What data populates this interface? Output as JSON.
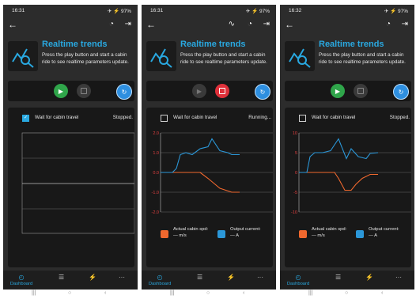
{
  "screens": [
    {
      "status_time": "16:31",
      "status_right": "✈ ⚡ 97%",
      "title": "Realtime trends",
      "description": "Press the play button and start a cabin ride to see realtime parameters update.",
      "checkbox_label": "Wait for cabin travel",
      "checkbox_checked": true,
      "run_state": "Stopped.",
      "play_active": true,
      "stop_active": false,
      "chart_visible": false
    },
    {
      "status_time": "16:31",
      "status_right": "✈ ⚡ 97%",
      "title": "Realtime trends",
      "description": "Press the play button and start a cabin ride to see realtime parameters update.",
      "checkbox_label": "Wait for cabin travel",
      "checkbox_checked": false,
      "run_state": "Running...",
      "play_active": false,
      "stop_active": true,
      "chart_visible": true
    },
    {
      "status_time": "16:32",
      "status_right": "✈ ⚡ 97%",
      "title": "Realtime trends",
      "description": "Press the play button and start a cabin ride to see realtime parameters update.",
      "checkbox_label": "Wait for cabin travel",
      "checkbox_checked": false,
      "run_state": "Stopped.",
      "play_active": true,
      "stop_active": false,
      "chart_visible": true
    }
  ],
  "legend": {
    "speed_label": "Actual cabin spd:",
    "speed_value": "— m/s",
    "speed_color": "#f0682e",
    "current_label": "Output current:",
    "current_value": "— A",
    "current_color": "#2b97d8"
  },
  "nav": {
    "dashboard": "Dashboard",
    "more": "···"
  },
  "chart_data": [
    {
      "type": "line",
      "title": "",
      "ylim": [
        -2.0,
        2.0
      ],
      "y_ticks": [
        "2.0",
        "1.0",
        "0.0",
        "-1.0",
        "-2.0"
      ],
      "series": [
        {
          "name": "Actual cabin spd",
          "x": [
            0,
            0.5,
            0.6,
            0.75,
            0.9,
            1.0
          ],
          "y": [
            0,
            0,
            -0.3,
            -0.8,
            -1.0,
            -1.0
          ]
        },
        {
          "name": "Output current",
          "x": [
            0,
            0.15,
            0.2,
            0.25,
            0.32,
            0.4,
            0.5,
            0.6,
            0.65,
            0.75,
            0.85,
            0.9,
            1.0
          ],
          "y": [
            0,
            0,
            0.2,
            0.9,
            1.0,
            0.9,
            1.2,
            1.3,
            1.7,
            1.1,
            1.0,
            0.9,
            0.9
          ]
        }
      ]
    },
    {
      "type": "line",
      "title": "",
      "ylim": [
        -10,
        10
      ],
      "y_ticks": [
        "10",
        "5",
        "0",
        "-5",
        "-10"
      ],
      "series": [
        {
          "name": "Actual cabin spd",
          "x": [
            0,
            0.45,
            0.5,
            0.58,
            0.66,
            0.72,
            0.8,
            0.9,
            1.0
          ],
          "y": [
            0,
            0,
            -1.5,
            -4.5,
            -4.5,
            -3,
            -1.5,
            -0.5,
            -0.5
          ]
        },
        {
          "name": "Output current",
          "x": [
            0,
            0.1,
            0.14,
            0.2,
            0.3,
            0.4,
            0.5,
            0.6,
            0.66,
            0.75,
            0.85,
            0.9,
            1.0
          ],
          "y": [
            0,
            0,
            4,
            5,
            5,
            5.5,
            8.5,
            3.5,
            6,
            4,
            3.5,
            4.8,
            5
          ]
        }
      ]
    }
  ]
}
